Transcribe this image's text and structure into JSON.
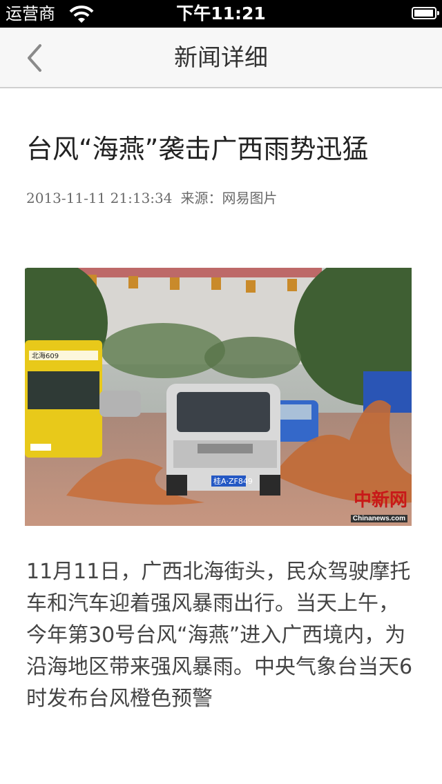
{
  "status_bar": {
    "carrier": "运营商",
    "time": "下午11:21",
    "battery_level": 0.95
  },
  "nav": {
    "title": "新闻详细",
    "back_icon": "chevron-left-icon"
  },
  "article": {
    "title": "台风“海燕”袭击广西雨势迅猛",
    "date": "2013-11-11 21:13:34",
    "source": "来源：网易图片",
    "image_watermark": "中新网",
    "image_watermark_site": "Chinanews.com",
    "bus_text": "北海609",
    "plate_text": "桂A·ZF849",
    "body": "11月11日，广西北海街头，民众驾驶摩托车和汽车迎着强风暴雨出行。当天上午，今年第30号台风“海燕”进入广西境内，为沿海地区带来强风暴雨。中央气象台当天6时发布台风橙色预警"
  },
  "colors": {
    "nav_bg": "#f7f7f7",
    "status_bg": "#000000",
    "watermark_red": "#c81919"
  }
}
